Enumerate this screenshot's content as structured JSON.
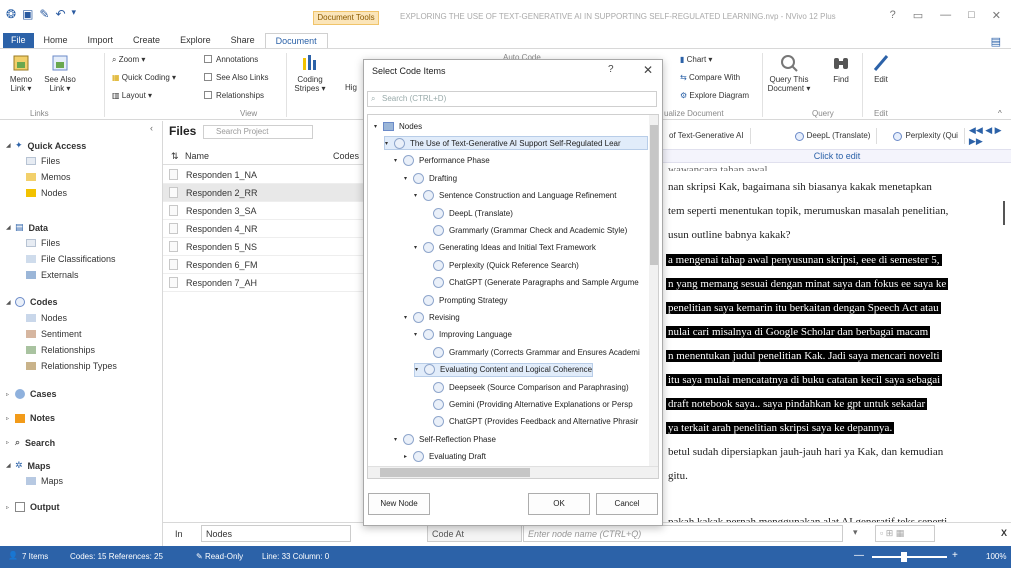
{
  "titlebar": {
    "context_tab": "Document Tools",
    "window_title": "EXPLORING THE USE OF TEXT-GENERATIVE AI IN SUPPORTING SELF-REGULATED LEARNING.nvp - NVivo 12 Plus",
    "help": "?",
    "minimize": "—",
    "maximize": "□",
    "close": "✕"
  },
  "tabs": [
    "File",
    "Home",
    "Import",
    "Create",
    "Explore",
    "Share",
    "Document"
  ],
  "ribbon": {
    "memo_link": "Memo\nLink ▾",
    "see_also_link": "See Also\nLink ▾",
    "links_group": "Links",
    "zoom": "Zoom ▾",
    "quick_coding": "Quick Coding ▾",
    "layout": "Layout ▾",
    "annotations": "Annotations",
    "see_also_links": "See Also Links",
    "relationships": "Relationships",
    "view_group": "View",
    "coding_stripes": "Coding\nStripes ▾",
    "hig": "Hig",
    "auto_code": "Auto Code",
    "chart": "Chart ▾",
    "compare_with": "Compare With",
    "explore_diagram": "Explore Diagram",
    "visualize_document": "ualize Document",
    "query_this": "Query This\nDocument ▾",
    "find": "Find",
    "edit": "Edit",
    "query_group": "Query",
    "edit_group": "Edit"
  },
  "nav": {
    "quick_access": "Quick Access",
    "files": "Files",
    "memos": "Memos",
    "nodes": "Nodes",
    "data": "Data",
    "data_files": "Files",
    "file_classifications": "File Classifications",
    "externals": "Externals",
    "codes": "Codes",
    "codes_nodes": "Nodes",
    "sentiment": "Sentiment",
    "relationships": "Relationships",
    "relationship_types": "Relationship Types",
    "cases": "Cases",
    "notes": "Notes",
    "search": "Search",
    "maps": "Maps",
    "maps_maps": "Maps",
    "output": "Output"
  },
  "files_pane": {
    "title": "Files",
    "search_placeholder": "Search Project",
    "col_name": "Name",
    "col_codes": "Codes",
    "rows": [
      "Responden 1_NA",
      "Responden 2_RR",
      "Responden 3_SA",
      "Responden 4_NR",
      "Responden 5_NS",
      "Responden 6_FM",
      "Responden 7_AH"
    ]
  },
  "doc": {
    "tabs": [
      "of Text-Generative AI",
      "DeepL (Translate)",
      "Perplexity (Qui"
    ],
    "click_to_edit": "Click to edit",
    "lines": [
      "nan skripsi Kak, bagaimana sih biasanya kakak menetapkan",
      "tem seperti menentukan topik, merumuskan masalah penelitian,",
      "usun outline babnya kakak?",
      "a mengenai tahap awal penyusunan skripsi, eee di semester 5,",
      "n yang memang sesuai dengan minat saya dan fokus ee saya ke",
      " penelitian saya kemarin itu berkaitan dengan Speech Act atau",
      "nulai cari misalnya di Google Scholar dan berbagai macam",
      "n menentukan judul penelitian Kak. Jadi saya mencari novelti",
      "itu saya mulai mencatatnya di buku catatan kecil saya sebagai",
      "draft notebook saya.. saya pindahkan ke gpt untuk sekadar",
      "ya terkait arah penelitian skripsi saya ke depannya.",
      "betul sudah dipersiapkan jauh-jauh hari ya Kak, dan kemudian",
      "gitu.",
      "pakah kakak pernah menggunakan alat AI generatif teks seperti"
    ]
  },
  "bottom": {
    "in_label": "In",
    "in_value": "Nodes",
    "code_at": "Code At",
    "node_placeholder": "Enter node name (CTRL+Q)",
    "x": "X"
  },
  "status": {
    "items": "7 Items",
    "codes_refs": "Codes: 15 References: 25",
    "readonly": "Read-Only",
    "line_col": "Line: 33 Column: 0",
    "zoom": "100%"
  },
  "dialog": {
    "title": "Select Code Items",
    "help": "?",
    "close": "✕",
    "search_placeholder": "Search (CTRL+D)",
    "tree": [
      {
        "label": "Nodes",
        "depth": 0,
        "exp": "▾",
        "icon": "folder"
      },
      {
        "label": "The Use of Text-Generative AI Support Self-Regulated Lear",
        "depth": 1,
        "exp": "▾",
        "sel": true
      },
      {
        "label": "Performance Phase",
        "depth": 2,
        "exp": "▾"
      },
      {
        "label": "Drafting",
        "depth": 3,
        "exp": "▾"
      },
      {
        "label": "Sentence Construction and Language Refinement",
        "depth": 4,
        "exp": "▾"
      },
      {
        "label": "DeepL (Translate)",
        "depth": 5,
        "exp": ""
      },
      {
        "label": "Grammarly (Grammar Check and Academic Style)",
        "depth": 5,
        "exp": ""
      },
      {
        "label": "Generating Ideas and Initial Text Framework",
        "depth": 4,
        "exp": "▾"
      },
      {
        "label": "Perplexity (Quick Reference Search)",
        "depth": 5,
        "exp": ""
      },
      {
        "label": "ChatGPT (Generate Paragraphs and Sample Argume",
        "depth": 5,
        "exp": ""
      },
      {
        "label": "Prompting Strategy",
        "depth": 4,
        "exp": ""
      },
      {
        "label": "Revising",
        "depth": 3,
        "exp": "▾"
      },
      {
        "label": "Improving Language",
        "depth": 4,
        "exp": "▾"
      },
      {
        "label": "Grammarly (Corrects Grammar and Ensures Academi",
        "depth": 5,
        "exp": ""
      },
      {
        "label": "Evaluating Content and Logical Coherence",
        "depth": 4,
        "exp": "▾",
        "hl": true
      },
      {
        "label": "Deepseek (Source Comparison and Paraphrasing)",
        "depth": 5,
        "exp": ""
      },
      {
        "label": "Gemini (Providing Alternative Explanations or Persp",
        "depth": 5,
        "exp": ""
      },
      {
        "label": "ChatGPT (Provides Feedback and Alternative Phrasir",
        "depth": 5,
        "exp": ""
      },
      {
        "label": "Self-Reflection Phase",
        "depth": 2,
        "exp": "▾"
      },
      {
        "label": "Evaluating Draft",
        "depth": 3,
        "exp": "▸"
      }
    ],
    "new_node": "New Node",
    "ok": "OK",
    "cancel": "Cancel"
  }
}
